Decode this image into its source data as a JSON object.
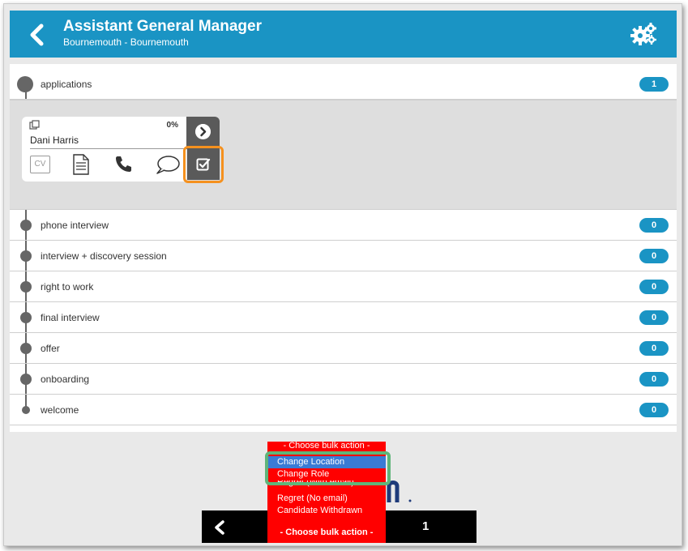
{
  "header": {
    "title": "Assistant General Manager",
    "subtitle": "Bournemouth - Bournemouth"
  },
  "stages": [
    {
      "label": "applications",
      "count": "1"
    },
    {
      "label": "phone interview",
      "count": "0"
    },
    {
      "label": "interview + discovery session",
      "count": "0"
    },
    {
      "label": "right to work",
      "count": "0"
    },
    {
      "label": "final interview",
      "count": "0"
    },
    {
      "label": "offer",
      "count": "0"
    },
    {
      "label": "onboarding",
      "count": "0"
    },
    {
      "label": "welcome",
      "count": "0"
    }
  ],
  "candidate": {
    "name": "Dani Harris",
    "progress": "0%",
    "cv_label": "CV"
  },
  "bulk_action": {
    "header_label": "- Choose bulk action -",
    "options": [
      "Change Location",
      "Change Role",
      "Regret (With email)",
      "Regret (No email)",
      "Candidate Withdrawn"
    ],
    "selected_index": 0,
    "current_label": "- Choose bulk action -"
  },
  "pagination": {
    "page": "1"
  },
  "colors": {
    "brand_blue": "#1a94c4",
    "dropdown_red": "#ff0000",
    "highlight_orange": "#f5911e",
    "highlight_green": "#5fb57a"
  },
  "icons": {
    "back": "chevron-left-icon",
    "settings": "gears-icon",
    "copy": "copy-icon",
    "cv": "cv-icon",
    "document": "document-icon",
    "phone": "phone-icon",
    "chat": "chat-icon",
    "next": "arrow-right-circle-icon",
    "select": "checkbox-icon"
  }
}
